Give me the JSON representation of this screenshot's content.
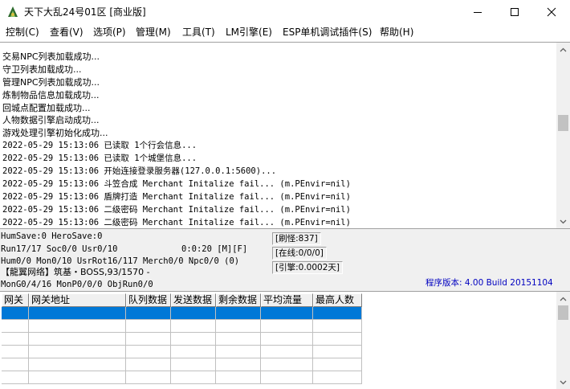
{
  "window": {
    "title": "天下大乱24号01区 [商业版]",
    "accent": "#0078d7"
  },
  "menu": [
    "控制(C)",
    "查看(V)",
    "选项(P)",
    "管理(M)",
    "工具(T)",
    "LM引擎(E)",
    "ESP单机调试插件(S)",
    "帮助(H)"
  ],
  "log": [
    "交易NPC列表加载成功...",
    "守卫列表加载成功...",
    "管理NPC列表加载成功...",
    "炼制物品信息加载成功...",
    "回城点配置加载成功...",
    "人物数据引擎启动成功...",
    "游戏处理引擎初始化成功...",
    "2022-05-29 15:13:06 已读取 1个行会信息...",
    "2022-05-29 15:13:06 已读取 1个城堡信息...",
    "2022-05-29 15:13:06 开始连接登录服务器(127.0.0.1:5600)...",
    "2022-05-29 15:13:06 斗笠合成 Merchant Initalize fail... (m.PEnvir=nil)",
    "2022-05-29 15:13:06 盾牌打造 Merchant Initalize fail... (m.PEnvir=nil)",
    "2022-05-29 15:13:06 二级密码 Merchant Initalize fail... (m.PEnvir=nil)",
    "2022-05-29 15:13:06 二级密码 Merchant Initalize fail... (m.PEnvir=nil)"
  ],
  "status": {
    "line1": "HumSave:0 HeroSave:0",
    "line2": "Run17/17 Soc0/0 Usr0/10",
    "timer": "0:0:20 [M][F]",
    "line3": "Hum0/0 Mon0/10 UsrRot16/117 Merch0/0 Npc0/0 (0)",
    "line4": "【龍翼网络】筑基・BOSS,93/1570 -",
    "line5": "MonG0/4/16 MonP0/0/0 ObjRun0/0",
    "box1": "[刷怪:837]",
    "box2": "[在线:0/0/0]",
    "box3": "[引擎:0.0002天]",
    "version": "程序版本: 4.00 Build 20151104"
  },
  "grid": {
    "columns": [
      "网关",
      "网关地址",
      "队列数据",
      "发送数据",
      "剩余数据",
      "平均流量",
      "最高人数"
    ],
    "selected_row": 0
  }
}
